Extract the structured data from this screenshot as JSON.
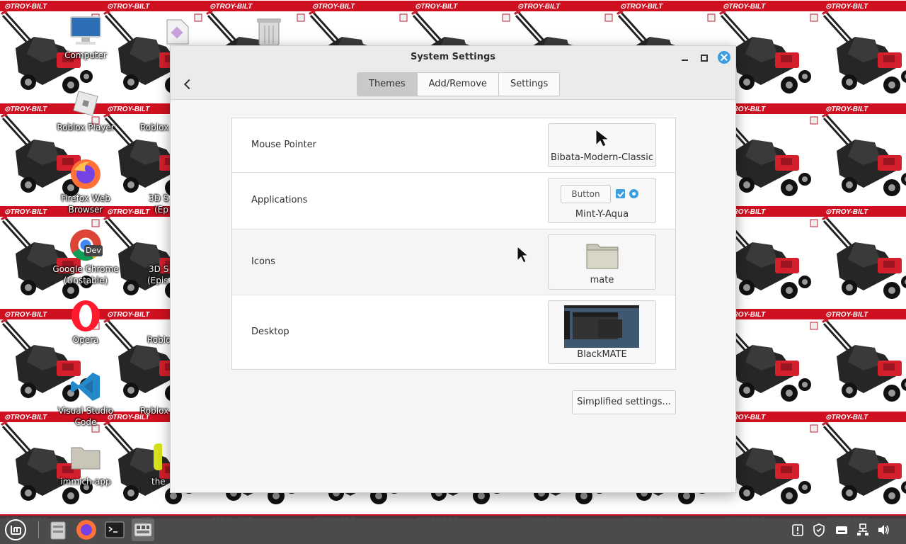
{
  "wallpaper": {
    "brand_text": "TROY-BILT",
    "brand_color": "#cf1020"
  },
  "desktop_icons": [
    {
      "label": "Computer",
      "icon": "computer-icon"
    },
    {
      "label": "Roblox Player",
      "icon": "roblox-icon"
    },
    {
      "label": "Roblox",
      "icon": "roblox-icon"
    },
    {
      "label": "Firefox Web Browser",
      "icon": "firefox-icon"
    },
    {
      "label": "3D S",
      "icon": "app-icon"
    },
    {
      "label": "(Ep",
      "icon": "app-icon"
    },
    {
      "label": "Google Chrome (Unstable)",
      "icon": "chrome-dev-icon",
      "badge": "Dev"
    },
    {
      "label": "3D S",
      "icon": "app-icon"
    },
    {
      "label": "(Epis",
      "icon": "app-icon"
    },
    {
      "label": "Opera",
      "icon": "opera-icon"
    },
    {
      "label": "Roblo",
      "icon": "roblox-icon"
    },
    {
      "label": "Visual Studio Code",
      "icon": "vscode-icon"
    },
    {
      "label": "Roblox",
      "icon": "roblox-icon"
    },
    {
      "label": "immich-app",
      "icon": "folder-icon"
    },
    {
      "label": "the",
      "icon": "app-icon"
    }
  ],
  "window": {
    "title": "System Settings",
    "tabs": [
      {
        "label": "Themes",
        "active": true
      },
      {
        "label": "Add/Remove",
        "active": false
      },
      {
        "label": "Settings",
        "active": false
      }
    ],
    "rows": [
      {
        "label": "Mouse Pointer",
        "value": "Bibata-Modern-Classic"
      },
      {
        "label": "Applications",
        "value": "Mint-Y-Aqua",
        "preview_button": "Button"
      },
      {
        "label": "Icons",
        "value": "mate"
      },
      {
        "label": "Desktop",
        "value": "BlackMATE"
      }
    ],
    "simplified_button": "Simplified settings...",
    "accent_color": "#3a9ee0"
  },
  "taskbar": {
    "launchers": [
      "menu-icon",
      "file-manager-icon",
      "firefox-icon",
      "terminal-icon",
      "system-settings-icon"
    ],
    "tray": [
      "update-icon",
      "shield-icon",
      "keyboard-icon",
      "network-icon",
      "volume-icon"
    ]
  }
}
